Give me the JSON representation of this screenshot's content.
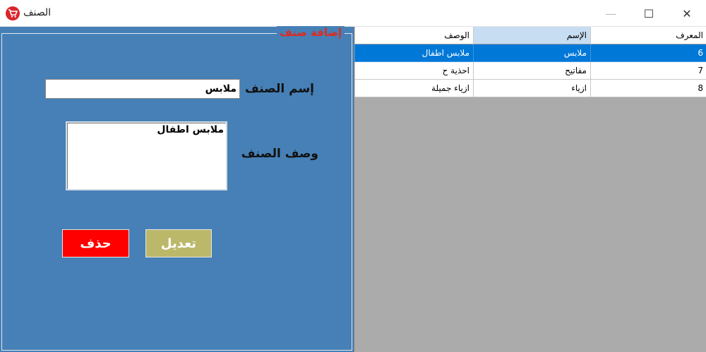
{
  "window": {
    "title": "الصنف",
    "controls": {
      "minimize": "—",
      "maximize": "☐",
      "close": "✕"
    }
  },
  "form": {
    "group_title": "إضافة صنف",
    "name_label": "إسم الصنف",
    "name_value": "ملابس",
    "desc_label": "وصف الصنف",
    "desc_value": "ملابس اطفال",
    "edit_button": "تعديل",
    "delete_button": "حذف"
  },
  "grid": {
    "columns": [
      "المعرف",
      "الإسم",
      "الوصف"
    ],
    "rows": [
      {
        "id": "6",
        "name": "ملابس",
        "desc": "ملابس اطفال",
        "selected": true
      },
      {
        "id": "7",
        "name": "مفاتيح",
        "desc": "احذية ح",
        "selected": false
      },
      {
        "id": "8",
        "name": "ازياء",
        "desc": "ازياء جميلة",
        "selected": false
      }
    ]
  },
  "colors": {
    "panel": "#4680b6",
    "accent_title": "#e02a1f",
    "edit_button": "#bcb86a",
    "delete_button": "#ff0000",
    "selection": "#0078d7",
    "grid_background": "#ababab",
    "header_highlight": "#c7ddf2"
  },
  "icons": {
    "app": "shopping-cart-icon"
  }
}
